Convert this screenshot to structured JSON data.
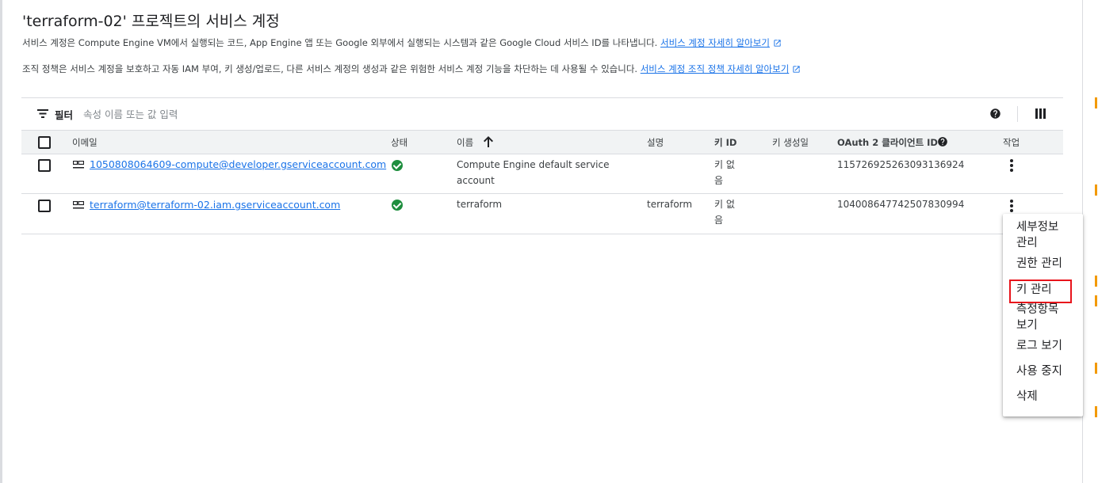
{
  "page": {
    "title": "'terraform-02' 프로젝트의 서비스 계정",
    "description": "서비스 계정은 Compute Engine VM에서 실행되는 코드, App Engine 앱 또는 Google 외부에서 실행되는 시스템과 같은 Google Cloud 서비스 ID를 나타냅니다.",
    "description_link": "서비스 계정 자세히 알아보기",
    "policy": "조직 정책은 서비스 계정을 보호하고 자동 IAM 부여, 키 생성/업로드, 다른 서비스 계정의 생성과 같은 위험한 서비스 계정 기능을 차단하는 데 사용될 수 있습니다.",
    "policy_link": "서비스 계정 조직 정책 자세히 알아보기"
  },
  "toolbar": {
    "filter_label": "필터",
    "filter_placeholder": "속성 이름 또는 값 입력"
  },
  "table": {
    "columns": {
      "email": "이메일",
      "status": "상태",
      "name": "이름",
      "description": "설명",
      "key_id": "키 ID",
      "key_created": "키 생성일",
      "oauth": "OAuth 2 클라이언트 ID",
      "actions": "작업"
    },
    "rows": [
      {
        "email": "1050808064609-compute@developer.gserviceaccount.com",
        "name": "Compute Engine default service account",
        "description": "",
        "key_id": "키 없음",
        "key_created": "",
        "oauth": "115726925263093136924"
      },
      {
        "email": "terraform@terraform-02.iam.gserviceaccount.com",
        "name": "terraform",
        "description": "terraform",
        "key_id": "키 없음",
        "key_created": "",
        "oauth": "104008647742507830994"
      }
    ]
  },
  "menu": {
    "items": [
      "세부정보 관리",
      "권한 관리",
      "키 관리",
      "측정항목 보기",
      "로그 보기",
      "사용 중지",
      "삭제"
    ],
    "highlighted": "키 관리"
  },
  "colors": {
    "link": "#1a73e8",
    "status_ok": "#1e8e3e",
    "highlight_border": "#e8141b",
    "header_bg": "#f1f3f4"
  },
  "icons": {
    "filter": "filter-list-icon",
    "help": "help-circle-icon",
    "columns": "column-display-icon",
    "sort": "arrow-up-icon",
    "status": "check-circle-icon",
    "account": "service-account-icon",
    "actions": "more-vert-icon",
    "external": "open-in-new-icon"
  }
}
